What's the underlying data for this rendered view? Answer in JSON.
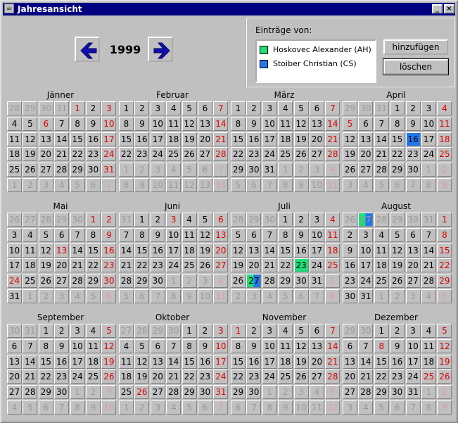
{
  "window": {
    "title": "Jahresansicht",
    "minimize": "_",
    "close": "×"
  },
  "nav": {
    "year": "1999"
  },
  "entries": {
    "label": "Einträge von:",
    "people": [
      {
        "name": "Hoskovec Alexander (AH)",
        "color": "#22dd77"
      },
      {
        "name": "Stoiber Christian (CS)",
        "color": "#2277ee"
      }
    ],
    "add_label": "hinzufügen",
    "delete_label": "löschen"
  },
  "months": [
    {
      "name": "Jänner",
      "days": [
        [
          28,
          29,
          30,
          31,
          1,
          2,
          3
        ],
        [
          4,
          5,
          6,
          7,
          8,
          9,
          10
        ],
        [
          11,
          12,
          13,
          14,
          15,
          16,
          17
        ],
        [
          18,
          19,
          20,
          21,
          22,
          23,
          24
        ],
        [
          25,
          26,
          27,
          28,
          29,
          30,
          31
        ],
        [
          1,
          2,
          3,
          4,
          5,
          6,
          7
        ]
      ],
      "leading": 4,
      "trailing": 7,
      "holidays": [
        1,
        6
      ],
      "marks": []
    },
    {
      "name": "Februar",
      "days": [
        [
          1,
          2,
          3,
          4,
          5,
          6,
          7
        ],
        [
          8,
          9,
          10,
          11,
          12,
          13,
          14
        ],
        [
          15,
          16,
          17,
          18,
          19,
          20,
          21
        ],
        [
          22,
          23,
          24,
          25,
          26,
          27,
          28
        ],
        [
          1,
          2,
          3,
          4,
          5,
          6,
          7
        ],
        [
          8,
          9,
          10,
          11,
          12,
          13,
          14
        ]
      ],
      "leading": 0,
      "trailing": 14,
      "holidays": [],
      "marks": []
    },
    {
      "name": "März",
      "days": [
        [
          1,
          2,
          3,
          4,
          5,
          6,
          7
        ],
        [
          8,
          9,
          10,
          11,
          12,
          13,
          14
        ],
        [
          15,
          16,
          17,
          18,
          19,
          20,
          21
        ],
        [
          22,
          23,
          24,
          25,
          26,
          27,
          28
        ],
        [
          29,
          30,
          31,
          1,
          2,
          3,
          4
        ],
        [
          5,
          6,
          7,
          8,
          9,
          10,
          11
        ]
      ],
      "leading": 0,
      "trailing": 11,
      "holidays": [],
      "marks": []
    },
    {
      "name": "April",
      "days": [
        [
          29,
          30,
          31,
          1,
          2,
          3,
          4
        ],
        [
          5,
          6,
          7,
          8,
          9,
          10,
          11
        ],
        [
          12,
          13,
          14,
          15,
          16,
          17,
          18
        ],
        [
          19,
          20,
          21,
          22,
          23,
          24,
          25
        ],
        [
          26,
          27,
          28,
          29,
          30,
          1,
          2
        ],
        [
          3,
          4,
          5,
          6,
          7,
          8,
          9
        ]
      ],
      "leading": 3,
      "trailing": 9,
      "holidays": [
        5
      ],
      "marks": [
        {
          "day": 16,
          "kind": "mark2"
        }
      ]
    },
    {
      "name": "Mai",
      "days": [
        [
          26,
          27,
          28,
          29,
          30,
          1,
          2
        ],
        [
          3,
          4,
          5,
          6,
          7,
          8,
          9
        ],
        [
          10,
          11,
          12,
          13,
          14,
          15,
          16
        ],
        [
          17,
          18,
          19,
          20,
          21,
          22,
          23
        ],
        [
          24,
          25,
          26,
          27,
          28,
          29,
          30
        ],
        [
          31,
          1,
          2,
          3,
          4,
          5,
          6
        ]
      ],
      "leading": 5,
      "trailing": 6,
      "holidays": [
        1,
        13,
        24
      ],
      "marks": []
    },
    {
      "name": "Juni",
      "days": [
        [
          31,
          1,
          2,
          3,
          4,
          5,
          6
        ],
        [
          7,
          8,
          9,
          10,
          11,
          12,
          13
        ],
        [
          14,
          15,
          16,
          17,
          18,
          19,
          20
        ],
        [
          21,
          22,
          23,
          24,
          25,
          26,
          27
        ],
        [
          28,
          29,
          30,
          1,
          2,
          3,
          4
        ],
        [
          5,
          6,
          7,
          8,
          9,
          10,
          11
        ]
      ],
      "leading": 1,
      "trailing": 11,
      "holidays": [
        3
      ],
      "marks": []
    },
    {
      "name": "Juli",
      "days": [
        [
          28,
          29,
          30,
          1,
          2,
          3,
          4
        ],
        [
          5,
          6,
          7,
          8,
          9,
          10,
          11
        ],
        [
          12,
          13,
          14,
          15,
          16,
          17,
          18
        ],
        [
          19,
          20,
          21,
          22,
          23,
          24,
          25
        ],
        [
          26,
          27,
          28,
          29,
          30,
          31,
          1
        ],
        [
          2,
          3,
          4,
          5,
          6,
          7,
          8
        ]
      ],
      "leading": 3,
      "trailing": 8,
      "holidays": [],
      "marks": [
        {
          "day": 23,
          "kind": "mark1"
        },
        {
          "day": 27,
          "kind": "split"
        }
      ]
    },
    {
      "name": "August",
      "days": [
        [
          26,
          27,
          28,
          29,
          30,
          31,
          1
        ],
        [
          2,
          3,
          4,
          5,
          6,
          7,
          8
        ],
        [
          9,
          10,
          11,
          12,
          13,
          14,
          15
        ],
        [
          16,
          17,
          18,
          19,
          20,
          21,
          22
        ],
        [
          23,
          24,
          25,
          26,
          27,
          28,
          29
        ],
        [
          30,
          31,
          1,
          2,
          3,
          4,
          5
        ]
      ],
      "leading": 6,
      "trailing": 5,
      "holidays": [
        15
      ],
      "marks": [
        {
          "day": 27,
          "kind": "split",
          "leading": true
        }
      ]
    },
    {
      "name": "September",
      "days": [
        [
          30,
          31,
          1,
          2,
          3,
          4,
          5
        ],
        [
          6,
          7,
          8,
          9,
          10,
          11,
          12
        ],
        [
          13,
          14,
          15,
          16,
          17,
          18,
          19
        ],
        [
          20,
          21,
          22,
          23,
          24,
          25,
          26
        ],
        [
          27,
          28,
          29,
          30,
          1,
          2,
          3
        ],
        [
          4,
          5,
          6,
          7,
          8,
          9,
          10
        ]
      ],
      "leading": 2,
      "trailing": 10,
      "holidays": [],
      "marks": []
    },
    {
      "name": "Oktober",
      "days": [
        [
          27,
          28,
          29,
          30,
          1,
          2,
          3
        ],
        [
          4,
          5,
          6,
          7,
          8,
          9,
          10
        ],
        [
          11,
          12,
          13,
          14,
          15,
          16,
          17
        ],
        [
          18,
          19,
          20,
          21,
          22,
          23,
          24
        ],
        [
          25,
          26,
          27,
          28,
          29,
          30,
          31
        ],
        [
          1,
          2,
          3,
          4,
          5,
          6,
          7
        ]
      ],
      "leading": 4,
      "trailing": 7,
      "holidays": [
        26
      ],
      "marks": []
    },
    {
      "name": "November",
      "days": [
        [
          1,
          2,
          3,
          4,
          5,
          6,
          7
        ],
        [
          8,
          9,
          10,
          11,
          12,
          13,
          14
        ],
        [
          15,
          16,
          17,
          18,
          19,
          20,
          21
        ],
        [
          22,
          23,
          24,
          25,
          26,
          27,
          28
        ],
        [
          29,
          30,
          1,
          2,
          3,
          4,
          5
        ],
        [
          6,
          7,
          8,
          9,
          10,
          11,
          12
        ]
      ],
      "leading": 0,
      "trailing": 12,
      "holidays": [
        1
      ],
      "marks": []
    },
    {
      "name": "Dezember",
      "days": [
        [
          29,
          30,
          1,
          2,
          3,
          4,
          5
        ],
        [
          6,
          7,
          8,
          9,
          10,
          11,
          12
        ],
        [
          13,
          14,
          15,
          16,
          17,
          18,
          19
        ],
        [
          20,
          21,
          22,
          23,
          24,
          25,
          26
        ],
        [
          27,
          28,
          29,
          30,
          31,
          1,
          2
        ],
        [
          3,
          4,
          5,
          6,
          7,
          8,
          9
        ]
      ],
      "leading": 2,
      "trailing": 9,
      "holidays": [
        8,
        25
      ],
      "marks": []
    }
  ]
}
